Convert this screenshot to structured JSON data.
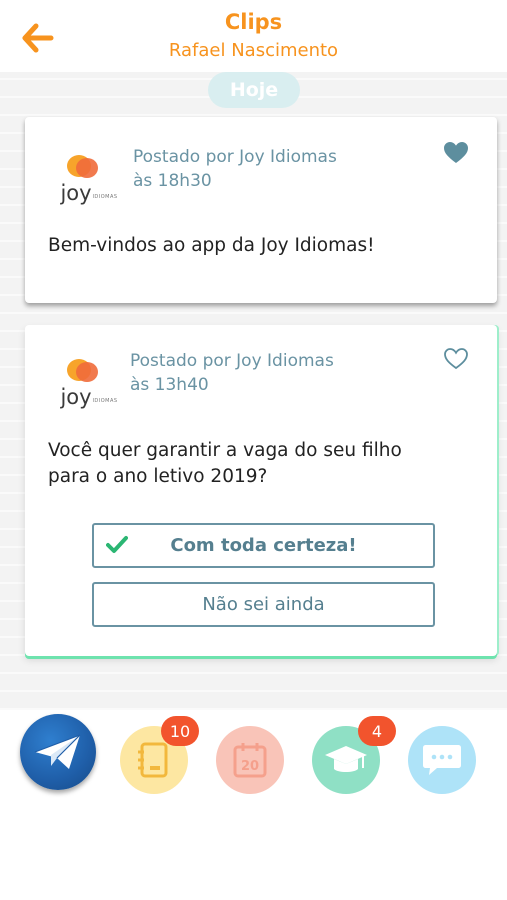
{
  "header": {
    "title": "Clips",
    "subtitle": "Rafael Nascimento"
  },
  "colors": {
    "accent": "#f7931e",
    "meta_text": "#6a93a3",
    "badge": "#f2542d",
    "highlight_border": "#6ee3ae"
  },
  "feed": {
    "day_label": "Hoje",
    "posts": [
      {
        "logo_text": "joy",
        "logo_small": "IDIOMAS",
        "posted_by": "Postado por Joy Idiomas",
        "time": "às 18h30",
        "message": "Bem-vindos ao app da Joy Idiomas!",
        "liked": true
      },
      {
        "logo_text": "joy",
        "logo_small": "IDIOMAS",
        "posted_by": "Postado por Joy Idiomas",
        "time": "às 13h40",
        "message_line1": "Você quer garantir a vaga do seu filho",
        "message_line2": "para o ano letivo 2019?",
        "liked": false,
        "answers": [
          {
            "label": "Com toda certeza!",
            "selected": true
          },
          {
            "label": "Não sei ainda",
            "selected": false
          }
        ]
      }
    ]
  },
  "dock": {
    "items": [
      {
        "icon": "paper-plane-icon"
      },
      {
        "icon": "notebook-icon",
        "badge": "10"
      },
      {
        "icon": "calendar-icon",
        "calendar_day": "20"
      },
      {
        "icon": "graduation-cap-icon",
        "badge": "4"
      },
      {
        "icon": "chat-bubble-icon"
      }
    ]
  }
}
